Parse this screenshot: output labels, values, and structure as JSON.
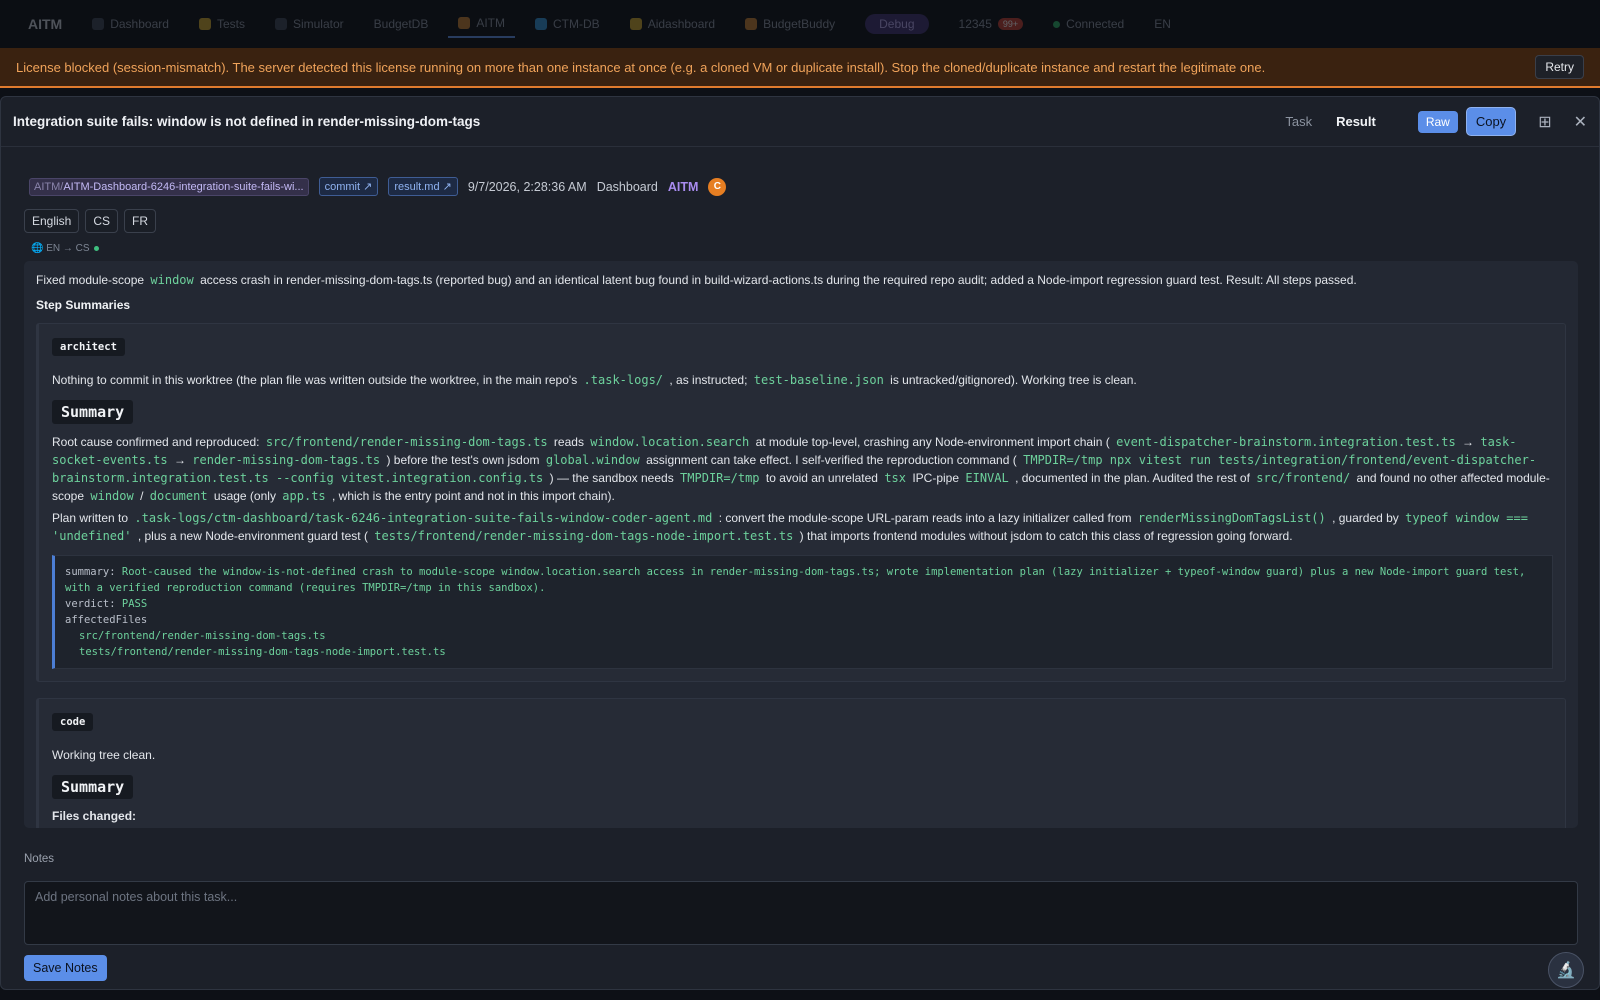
{
  "topnav": {
    "logo": "AITM",
    "items": [
      "Dashboard",
      "Tests",
      "Simulator",
      "BudgetDB",
      "AITM",
      "CTM-DB",
      "Aidashboard",
      "BudgetBuddy"
    ],
    "pill": "Debug",
    "stats": "12345",
    "badge": "99+",
    "connection": "Connected",
    "account": "EN"
  },
  "banner": {
    "message": "License blocked (session-mismatch). The server detected this license running on more than one instance at once (e.g. a cloned VM or duplicate install). Stop the cloned/duplicate instance and restart the legitimate one.",
    "retry_label": "Retry"
  },
  "modal": {
    "title": "Integration suite fails: window is not defined in render-missing-dom-tags",
    "tab_task": "Task",
    "tab_result": "Result",
    "raw_label": "Raw",
    "copy_label": "Copy"
  },
  "meta": {
    "path_prefix": "AITM/",
    "path_name": "AITM-Dashboard-6246-integration-suite-fails-wi...",
    "commit_label": "commit ↗",
    "result_label": "result.md ↗",
    "date": "9/7/2026, 2:28:36 AM",
    "section": "Dashboard",
    "project": "AITM",
    "avatar_initial": "C"
  },
  "languages": [
    "English",
    "CS",
    "FR"
  ],
  "translation_status": "🌐 EN → CS",
  "result": {
    "intro_a": "Fixed module-scope",
    "intro_code": "window",
    "intro_b": "access crash in render-missing-dom-tags.ts (reported bug) and an identical latent bug found in build-wizard-actions.ts during the required repo audit; added a Node-import regression guard test. Result: All steps passed.",
    "step_summaries_heading": "Step Summaries",
    "architect": {
      "tag": "architect",
      "p1_a": "Nothing to commit in this worktree (the plan file was written outside the worktree, in the main repo's",
      "p1_code1": ".task-logs/",
      "p1_b": ", as instructed;",
      "p1_code2": "test-baseline.json",
      "p1_c": "is untracked/gitignored). Working tree is clean.",
      "summary_heading": "Summary",
      "p2": {
        "t1": "Root cause confirmed and reproduced:",
        "c1": "src/frontend/render-missing-dom-tags.ts",
        "t2": "reads",
        "c2": "window.location.search",
        "t3": "at module top-level, crashing any Node-environment import chain (",
        "c3": "event-dispatcher-brainstorm.integration.test.ts",
        "t4": "→",
        "c4": "task-socket-events.ts",
        "t5": "→",
        "c5": "render-missing-dom-tags.ts",
        "t6": ") before the test's own jsdom",
        "c6": "global.window",
        "t7": "assignment can take effect. I self-verified the reproduction command (",
        "c7": "TMPDIR=/tmp npx vitest run tests/integration/frontend/event-dispatcher-brainstorm.integration.test.ts --config vitest.integration.config.ts",
        "t8": ") — the sandbox needs",
        "c8": "TMPDIR=/tmp",
        "t9": "to avoid an unrelated",
        "c9": "tsx",
        "t10": "IPC-pipe",
        "c10": "EINVAL",
        "t11": ", documented in the plan. Audited the rest of",
        "c11": "src/frontend/",
        "t12": "and found no other affected module-scope",
        "c12": "window",
        "t13": "/",
        "c13": "document",
        "t14": "usage (only",
        "c14": "app.ts",
        "t15": ", which is the entry point and not in this import chain)."
      },
      "p3": {
        "t1": "Plan written to",
        "c1": ".task-logs/ctm-dashboard/task-6246-integration-suite-fails-window-coder-agent.md",
        "t2": ": convert the module-scope URL-param reads into a lazy initializer called from",
        "c2": "renderMissingDomTagsList()",
        "t3": ", guarded by",
        "c3": "typeof window === 'undefined'",
        "t4": ", plus a new Node-environment guard test (",
        "c4": "tests/frontend/render-missing-dom-tags-node-import.test.ts",
        "t5": ") that imports frontend modules without jsdom to catch this class of regression going forward."
      },
      "yaml": {
        "summary_key": "summary:",
        "summary_val": "Root-caused the window-is-not-defined crash to module-scope window.location.search access in render-missing-dom-tags.ts; wrote implementation plan (lazy initializer + typeof-window guard) plus a new Node-import guard test, with a verified reproduction command (requires TMPDIR=/tmp in this sandbox).",
        "verdict_key": "verdict:",
        "verdict_val": "PASS",
        "files_key": "affectedFiles",
        "files": [
          "src/frontend/render-missing-dom-tags.ts",
          "tests/frontend/render-missing-dom-tags-node-import.test.ts"
        ]
      }
    },
    "code_step": {
      "tag": "code",
      "p1": "Working tree clean.",
      "summary_heading": "Summary",
      "files_changed": "Files changed:"
    }
  },
  "notes": {
    "label": "Notes",
    "placeholder": "Add personal notes about this task...",
    "save_label": "Save Notes"
  }
}
